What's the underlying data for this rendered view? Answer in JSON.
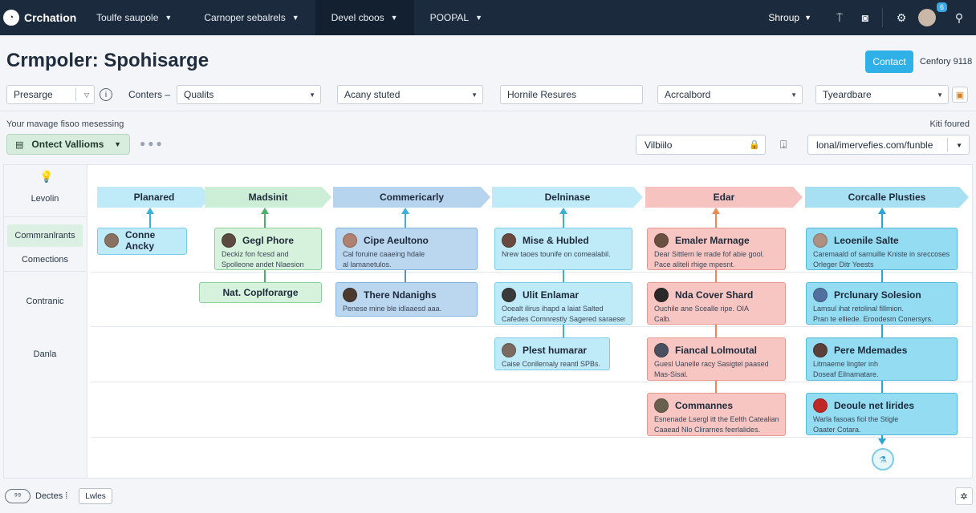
{
  "nav": {
    "brand": "Crchation",
    "brand_icon": "logo-icon",
    "tabs": [
      {
        "label": "Toulfe saupole",
        "active": false
      },
      {
        "label": "Carnoper sebalrels",
        "active": false
      },
      {
        "label": "Devel cboos",
        "active": true
      },
      {
        "label": "POOPAL",
        "active": false
      }
    ],
    "shop_label": "Shroup",
    "notification_count": "6"
  },
  "header": {
    "title": "Crmpoler: Spohisarge",
    "contact_label": "Contact",
    "company_label": "Cenfory 9118"
  },
  "filters": {
    "presarge": "Presarge",
    "conters_label": "Conters –",
    "qualits": "Qualits",
    "acany": "Acany stuted",
    "hornile": "Hornile Resures",
    "acrcalbord": "Acrcalbord",
    "tyeardbare": "Tyeardbare"
  },
  "subbar": {
    "note": "Your mavage fisoo mesessing",
    "found": "Kiti foured",
    "action_label": "Ontect Vallioms",
    "visibility_value": "Vilbiilo",
    "url_value": "lonal/imervefies.com/funble"
  },
  "lanes": [
    "Levolin",
    "Commranlrants",
    "Comections",
    "Contranic",
    "Danla"
  ],
  "stages": [
    {
      "label": "Planared",
      "color": "#bfeaf8"
    },
    {
      "label": "Madsinit",
      "color": "#cdeed6"
    },
    {
      "label": "Commericarly",
      "color": "#b6d4ee"
    },
    {
      "label": "Delninase",
      "color": "#bfeaf8"
    },
    {
      "label": "Edar",
      "color": "#f6c3c0"
    },
    {
      "label": "Corcalle Plusties",
      "color": "#a8e0f3"
    }
  ],
  "cards": {
    "c1": {
      "title": "Conne Ancky"
    },
    "c2": {
      "title": "Gegl Phore",
      "desc1": "Deckiz fon fcesd and",
      "desc2": "Spolleone andet Nlaesion"
    },
    "c3": {
      "title": "Nat. Coplforarge"
    },
    "c4": {
      "title": "Cipe Aeultono",
      "desc1": "Cal foruine caaeing hdale",
      "desc2": "al lamanetulos."
    },
    "c5": {
      "title": "There Ndanighs",
      "desc1": "Penese mine ble idlaaesd aaa."
    },
    "c6": {
      "title": "Mise & Hubled",
      "desc1": "Nrew taoes tounife on comealabil."
    },
    "c7": {
      "title": "Ulit Enlamar",
      "desc1": "Ooealt ilirus ihapd a laiat Salted",
      "desc2": "Cafedes Comnrestly Sagered saraeses."
    },
    "c8": {
      "title": "Plest humarar",
      "desc1": "Caise Conllernaly reantl SPBs."
    },
    "c9": {
      "title": "Emaler Marnage",
      "desc1": "Dear Sittlern le rrade fof abie gool.",
      "desc2": "Pace aliteli rhige mpesnt."
    },
    "c10": {
      "title": "Nda Cover Shard",
      "desc1": "Ouchile ane Scealle ripe. OIA",
      "desc2": "Calb."
    },
    "c11": {
      "title": "Fiancal Lolmoutal",
      "desc1": "Guesl Uanelle racy Sasigtel paased",
      "desc2": "Mas-Sisal."
    },
    "c12": {
      "title": "Commannes",
      "desc1": "Esnenade Lsergl itt the Eelth Catealian.",
      "desc2": "Caaead Nlo Clirarnes feerlalides."
    },
    "c13": {
      "title": "Leoenile Salte",
      "desc1": "Caremaald of sarnuille Kniste in sreccoses",
      "desc2": "Orleger Ditr Yeests"
    },
    "c14": {
      "title": "Prclunary Solesion",
      "desc1": "Lamsul ihat retolinal fillmion.",
      "desc2": "Pran te elliede. Eroodesm Conersyrs."
    },
    "c15": {
      "title": "Pere Mdemades",
      "desc1": "Litmaeme lingter inh",
      "desc2": "Doseaf Eilnamatare."
    },
    "c16": {
      "title": "Deoule net lirides",
      "desc1": "Warla fasoas fiol the Stigle",
      "desc2": "Oaater Cotara."
    }
  },
  "bottom": {
    "toggle": "⁹⁹",
    "label": "Dectes ⁞",
    "button": "Lwles"
  }
}
